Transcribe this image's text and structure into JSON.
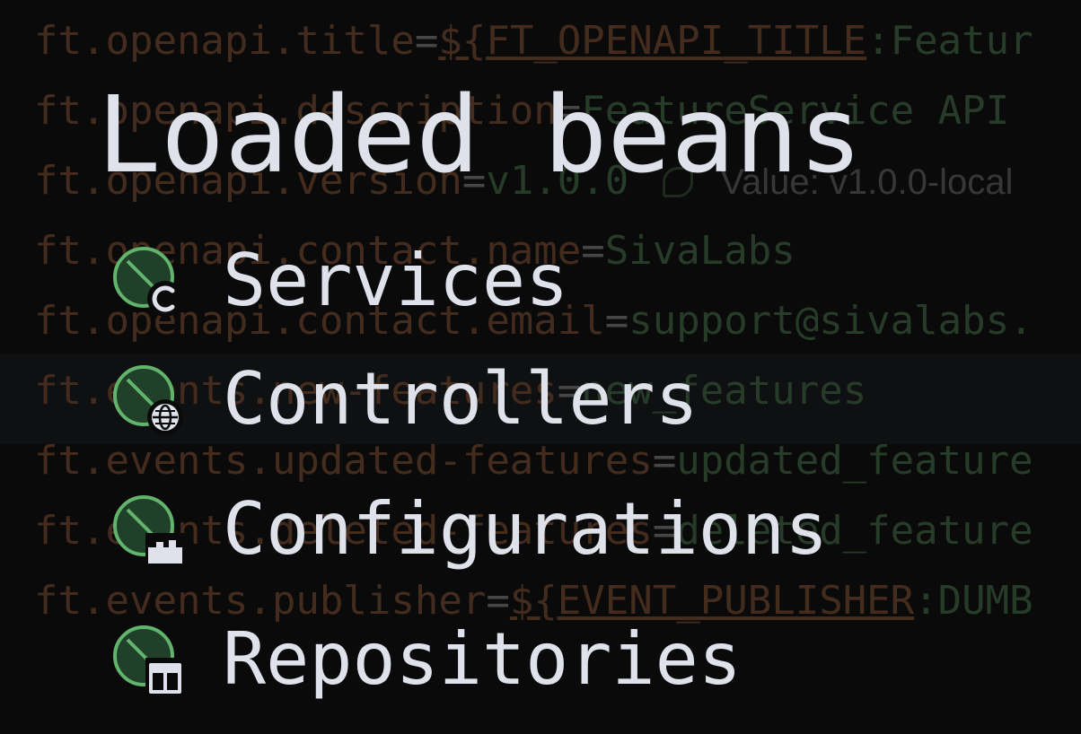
{
  "title": "Loaded beans",
  "beans": [
    {
      "label": "Services",
      "icon": "spring-bean-class-icon",
      "badge": "class-c-icon"
    },
    {
      "label": "Controllers",
      "icon": "spring-bean-web-icon",
      "badge": "globe-icon"
    },
    {
      "label": "Configurations",
      "icon": "spring-bean-config-icon",
      "badge": "factory-icon"
    },
    {
      "label": "Repositories",
      "icon": "spring-bean-repository-icon",
      "badge": "table-icon"
    }
  ],
  "background_editor": {
    "lines": [
      {
        "key": "ft.openapi.title",
        "eq": "=",
        "placeholder": "${FT_OPENAPI_TITLE",
        "value": ":Featur"
      },
      {
        "key": "ft.openapi.description",
        "eq": "=",
        "placeholder": "",
        "value": "FeatureService API"
      },
      {
        "key": "ft.openapi.version",
        "eq": "=",
        "placeholder": "",
        "value": "v1.0.0",
        "inlay": "Value: v1.0.0-local"
      },
      {
        "key": "ft.openapi.contact.name",
        "eq": "=",
        "placeholder": "",
        "value": "SivaLabs"
      },
      {
        "key": "ft.openapi.contact.email",
        "eq": "=",
        "placeholder": "",
        "value": "support@sivalabs."
      },
      {
        "key": "ft.events.new-features",
        "eq": "=",
        "placeholder": "",
        "value": "new_features"
      },
      {
        "key": "ft.events.updated-features",
        "eq": "=",
        "placeholder": "",
        "value": "updated_feature"
      },
      {
        "key": "ft.events.deleted-features",
        "eq": "=",
        "placeholder": "",
        "value": "deleted_feature"
      },
      {
        "key": "ft.events.publisher",
        "eq": "=",
        "placeholder": "${EVENT_PUBLISHER",
        "value": ":DUMB"
      }
    ]
  },
  "colors": {
    "leaf_fill": "#21402a",
    "leaf_stroke": "#62b36c",
    "badge": "#dfe2ea",
    "text": "#dfe2ea"
  }
}
